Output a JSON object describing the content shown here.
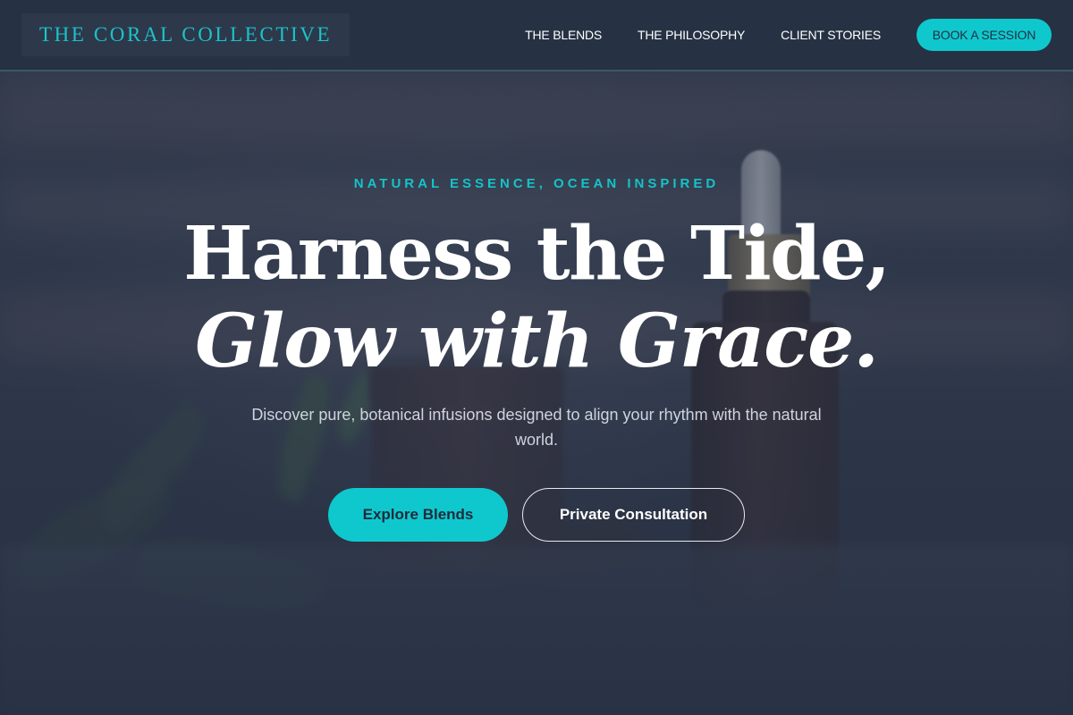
{
  "header": {
    "logo": "THE CORAL COLLECTIVE",
    "nav": [
      {
        "label": "THE BLENDS"
      },
      {
        "label": "THE PHILOSOPHY"
      },
      {
        "label": "CLIENT STORIES"
      }
    ],
    "cta_label": "BOOK A SESSION"
  },
  "hero": {
    "eyebrow": "NATURAL ESSENCE, OCEAN INSPIRED",
    "headline_line1": "Harness the Tide,",
    "headline_line2": "Glow with Grace.",
    "subtext": "Discover pure, botanical infusions designed to align your rhythm with the natural world.",
    "primary_cta": "Explore Blends",
    "secondary_cta": "Private Consultation"
  },
  "colors": {
    "accent": "#0fc8ce",
    "header_bg": "#263244",
    "hero_overlay": "#2b3648",
    "text": "#ffffff"
  }
}
